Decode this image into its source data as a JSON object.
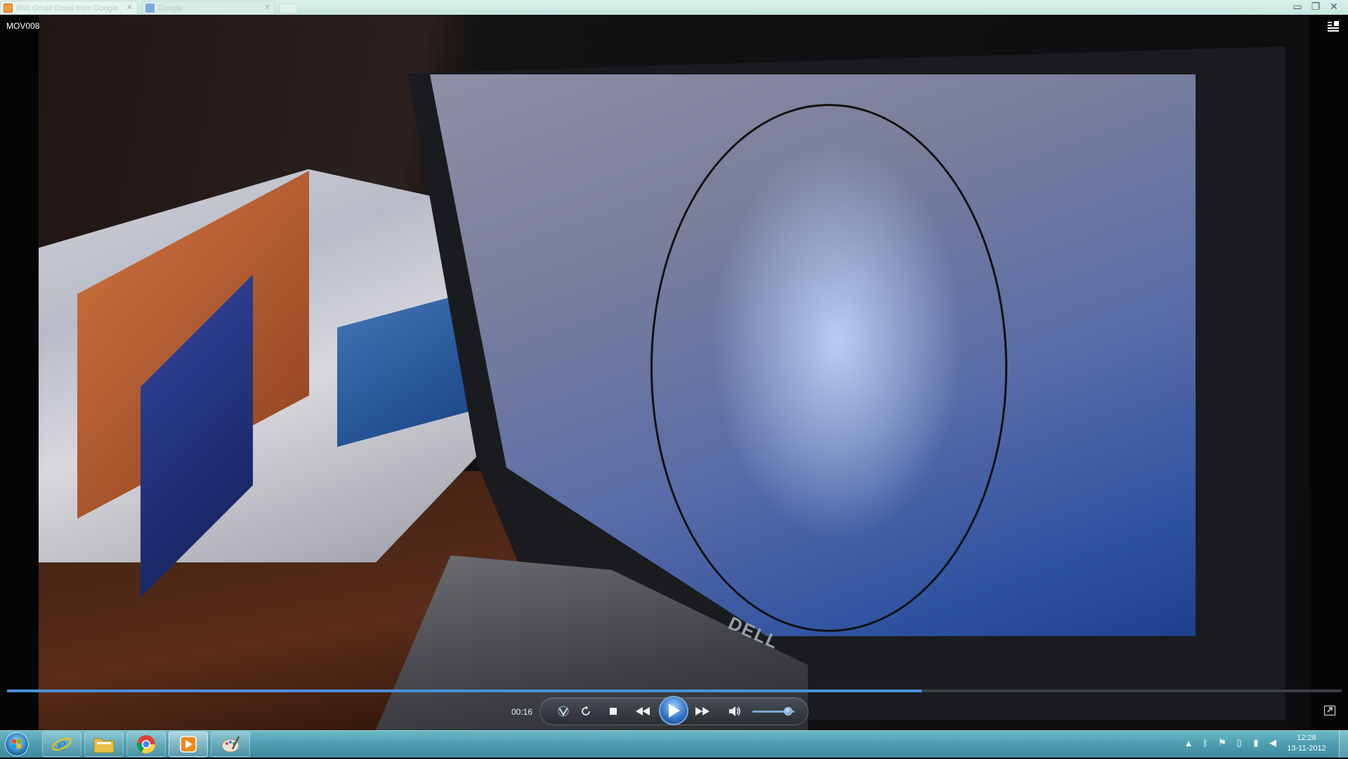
{
  "browser": {
    "tabs": [
      {
        "label": "(69) Gmail Email from Google",
        "favicon": "gmail-icon"
      },
      {
        "label": "Google",
        "favicon": "google-icon"
      }
    ],
    "window_controls": {
      "minimize": "▭",
      "restore": "❐",
      "close": "✕"
    }
  },
  "player": {
    "title": "MOV008",
    "current_time": "00:16",
    "progress_fraction": 0.685,
    "volume_fraction": 0.85,
    "icons": {
      "repeat": "repeat-icon",
      "shuffle": "shuffle-icon",
      "stop": "stop-icon",
      "previous": "previous-icon",
      "play": "play-icon",
      "next": "next-icon",
      "volume": "volume-icon",
      "fullscreen": "fullscreen-icon",
      "switch_to_library": "switch-library-icon"
    },
    "video_brand_text": "DELL"
  },
  "taskbar": {
    "apps": [
      {
        "name": "internet-explorer",
        "icon": "ie-icon",
        "state": "pinned"
      },
      {
        "name": "windows-explorer",
        "icon": "folder-icon",
        "state": "pinned"
      },
      {
        "name": "google-chrome",
        "icon": "chrome-icon",
        "state": "pinned"
      },
      {
        "name": "windows-media-player",
        "icon": "media-player-icon",
        "state": "active"
      },
      {
        "name": "paint",
        "icon": "paint-icon",
        "state": "pinned"
      }
    ],
    "tray_icons": [
      "tray-expand-icon",
      "bluetooth-icon",
      "action-center-icon",
      "power-icon",
      "network-icon",
      "speaker-icon"
    ],
    "clock": {
      "time": "12:28",
      "date": "13-11-2012"
    }
  },
  "colors": {
    "accent": "#4d8fd9",
    "taskbar": "#4f9fb1"
  }
}
